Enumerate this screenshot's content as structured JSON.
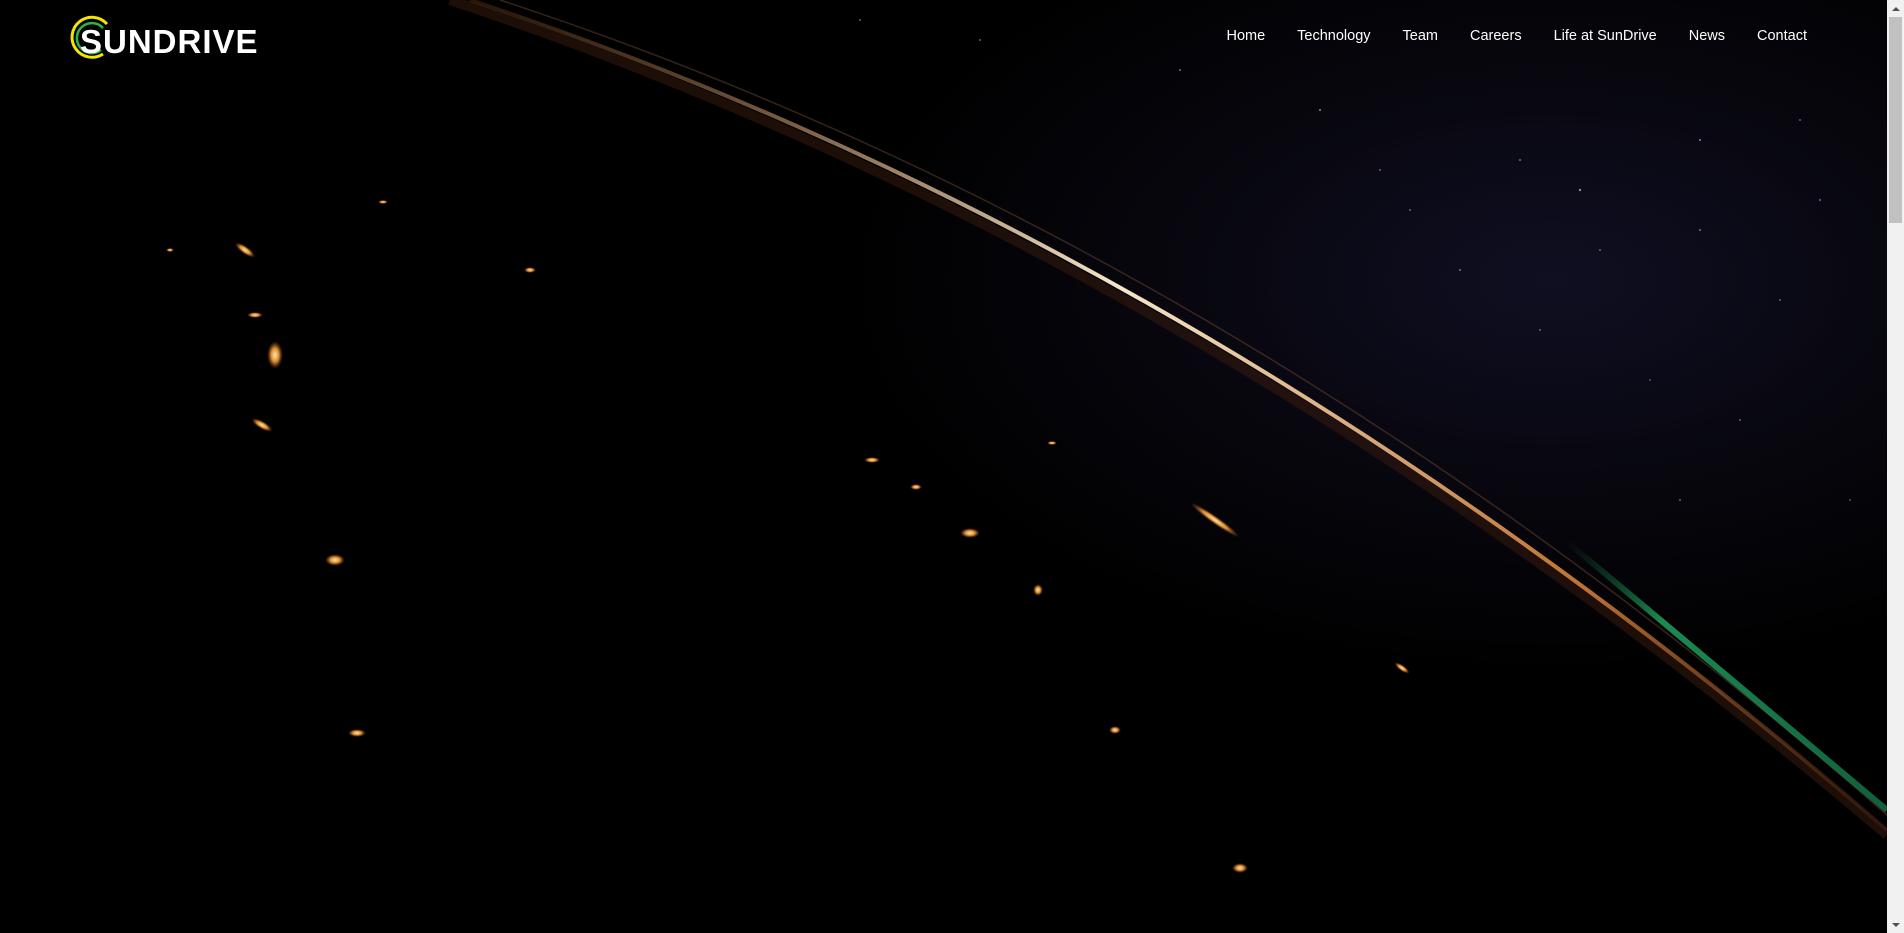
{
  "site": {
    "logo_text": "SUNDRIVE",
    "logo_icon": "sun-crescent-icon"
  },
  "nav": {
    "items": [
      {
        "label": "Home"
      },
      {
        "label": "Technology"
      },
      {
        "label": "Team"
      },
      {
        "label": "Careers"
      },
      {
        "label": "Life at SunDrive"
      },
      {
        "label": "News"
      },
      {
        "label": "Contact"
      }
    ]
  },
  "hero": {
    "image": "earth-at-night-from-orbit"
  },
  "colors": {
    "background": "#000000",
    "nav_text": "#ffffff",
    "logo_yellow": "#f2e600",
    "logo_green": "#2db34a",
    "scrollbar_track": "#f1f1f1",
    "scrollbar_thumb": "#c1c1c1"
  },
  "scrollbar": {
    "up_icon": "scroll-up-arrow-icon",
    "down_icon": "scroll-down-arrow-icon"
  }
}
